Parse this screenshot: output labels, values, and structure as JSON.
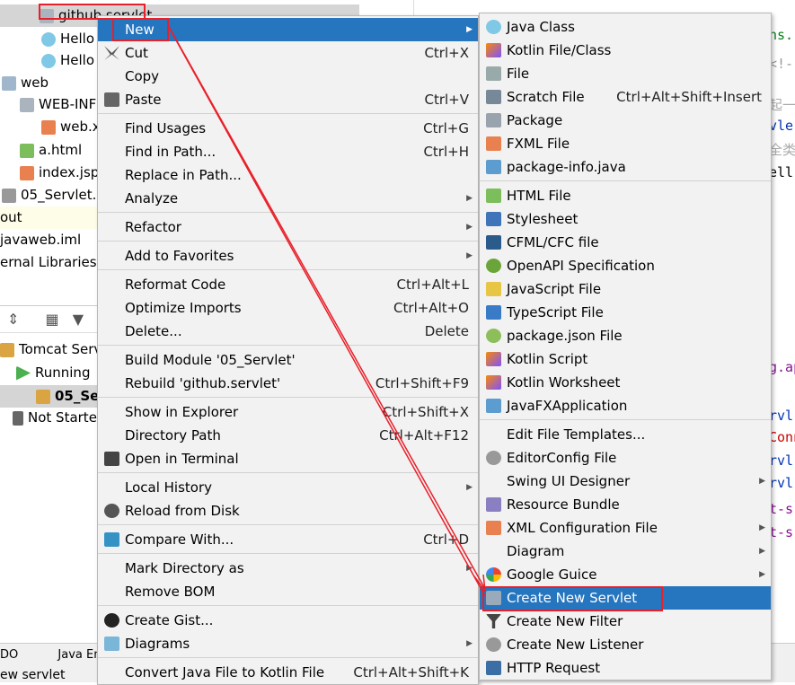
{
  "project_tree": {
    "items": [
      {
        "label": "github.servlet",
        "icon": "folder-icon",
        "selected": true
      },
      {
        "label": "Hello",
        "icon": "java-class-icon"
      },
      {
        "label": "Hello",
        "icon": "java-class-icon"
      },
      {
        "label": "web",
        "icon": "web-folder-icon"
      },
      {
        "label": "WEB-INF",
        "icon": "folder-icon"
      },
      {
        "label": "web.x",
        "icon": "xml-file-icon"
      },
      {
        "label": "a.html",
        "icon": "html-file-icon"
      },
      {
        "label": "index.jsp",
        "icon": "jsp-file-icon"
      },
      {
        "label": "05_Servlet.i",
        "icon": "iml-file-icon"
      },
      {
        "label": "out",
        "icon": ""
      },
      {
        "label": "javaweb.iml",
        "icon": ""
      },
      {
        "label": "ernal Libraries",
        "icon": ""
      }
    ]
  },
  "run_panel": {
    "items": [
      {
        "label": "Tomcat Serv",
        "icon": "tomcat-icon"
      },
      {
        "label": "Running",
        "icon": "play-icon"
      },
      {
        "label": "05_Ser",
        "icon": "tomcat-icon"
      },
      {
        "label": "Not Starte",
        "icon": "wrench-icon"
      }
    ]
  },
  "code_fragments": [
    "ns.",
    "<!--",
    "起一",
    "vle",
    "全类",
    "ell",
    "g.ap",
    "rvl",
    "Conn",
    "rvl",
    "rvl",
    "t-s",
    "t-s"
  ],
  "bottom_tabs": [
    "DO",
    "Java En"
  ],
  "status_text": "ew servlet",
  "context_menu": {
    "items": [
      {
        "label": "New",
        "submenu": true,
        "highlighted": true
      },
      {
        "label": "Cut",
        "shortcut": "Ctrl+X",
        "icon": "scissors-icon"
      },
      {
        "label": "Copy"
      },
      {
        "label": "Paste",
        "shortcut": "Ctrl+V",
        "icon": "clipboard-icon"
      },
      {
        "sep": true
      },
      {
        "label": "Find Usages",
        "shortcut": "Ctrl+G"
      },
      {
        "label": "Find in Path...",
        "shortcut": "Ctrl+H"
      },
      {
        "label": "Replace in Path..."
      },
      {
        "label": "Analyze",
        "submenu": true
      },
      {
        "sep": true
      },
      {
        "label": "Refactor",
        "submenu": true
      },
      {
        "sep": true
      },
      {
        "label": "Add to Favorites",
        "submenu": true
      },
      {
        "sep": true
      },
      {
        "label": "Reformat Code",
        "shortcut": "Ctrl+Alt+L"
      },
      {
        "label": "Optimize Imports",
        "shortcut": "Ctrl+Alt+O"
      },
      {
        "label": "Delete...",
        "shortcut": "Delete"
      },
      {
        "sep": true
      },
      {
        "label": "Build Module '05_Servlet'"
      },
      {
        "label": "Rebuild 'github.servlet'",
        "shortcut": "Ctrl+Shift+F9"
      },
      {
        "sep": true
      },
      {
        "label": "Show in Explorer",
        "shortcut": "Ctrl+Shift+X"
      },
      {
        "label": "Directory Path",
        "shortcut": "Ctrl+Alt+F12"
      },
      {
        "label": "Open in Terminal",
        "icon": "terminal-icon"
      },
      {
        "sep": true
      },
      {
        "label": "Local History",
        "submenu": true
      },
      {
        "label": "Reload from Disk",
        "icon": "reload-icon"
      },
      {
        "sep": true
      },
      {
        "label": "Compare With...",
        "shortcut": "Ctrl+D",
        "icon": "compare-icon"
      },
      {
        "sep": true
      },
      {
        "label": "Mark Directory as",
        "submenu": true
      },
      {
        "label": "Remove BOM"
      },
      {
        "sep": true
      },
      {
        "label": "Create Gist...",
        "icon": "github-icon"
      },
      {
        "label": "Diagrams",
        "submenu": true,
        "icon": "diagram-icon"
      },
      {
        "sep": true
      },
      {
        "label": "Convert Java File to Kotlin File",
        "shortcut": "Ctrl+Alt+Shift+K"
      }
    ]
  },
  "new_submenu": {
    "items": [
      {
        "label": "Java Class",
        "icon": "java-class-icon"
      },
      {
        "label": "Kotlin File/Class",
        "icon": "kotlin-file-icon"
      },
      {
        "label": "File",
        "icon": "file-icon"
      },
      {
        "label": "Scratch File",
        "shortcut": "Ctrl+Alt+Shift+Insert",
        "icon": "scratch-file-icon"
      },
      {
        "label": "Package",
        "icon": "package-icon"
      },
      {
        "label": "FXML File",
        "icon": "fxml-file-icon"
      },
      {
        "label": "package-info.java",
        "icon": "java-file-icon"
      },
      {
        "sep": true
      },
      {
        "label": "HTML File",
        "icon": "html-file-icon"
      },
      {
        "label": "Stylesheet",
        "icon": "css-icon"
      },
      {
        "label": "CFML/CFC file",
        "icon": "cfml-icon"
      },
      {
        "label": "OpenAPI Specification",
        "icon": "openapi-icon"
      },
      {
        "label": "JavaScript File",
        "icon": "js-file-icon"
      },
      {
        "label": "TypeScript File",
        "icon": "ts-file-icon"
      },
      {
        "label": "package.json File",
        "icon": "nodejs-icon"
      },
      {
        "label": "Kotlin Script",
        "icon": "kotlin-script-icon"
      },
      {
        "label": "Kotlin Worksheet",
        "icon": "kotlin-worksheet-icon"
      },
      {
        "label": "JavaFXApplication",
        "icon": "java-file-icon"
      },
      {
        "sep": true
      },
      {
        "label": "Edit File Templates..."
      },
      {
        "label": "EditorConfig File",
        "icon": "gear-icon"
      },
      {
        "label": "Swing UI Designer",
        "submenu": true
      },
      {
        "label": "Resource Bundle",
        "icon": "resource-bundle-icon"
      },
      {
        "label": "XML Configuration File",
        "submenu": true,
        "icon": "xml-file-icon"
      },
      {
        "label": "Diagram",
        "submenu": true
      },
      {
        "label": "Google Guice",
        "submenu": true,
        "icon": "google-icon"
      },
      {
        "label": "Create New Servlet",
        "highlighted": true,
        "icon": "servlet-icon"
      },
      {
        "label": "Create New Filter",
        "icon": "filter-icon"
      },
      {
        "label": "Create New Listener",
        "icon": "listener-icon"
      },
      {
        "label": "HTTP Request",
        "icon": "api-icon"
      }
    ]
  },
  "colors": {
    "highlight": "#2675bf",
    "annotation": "#e8202a"
  }
}
